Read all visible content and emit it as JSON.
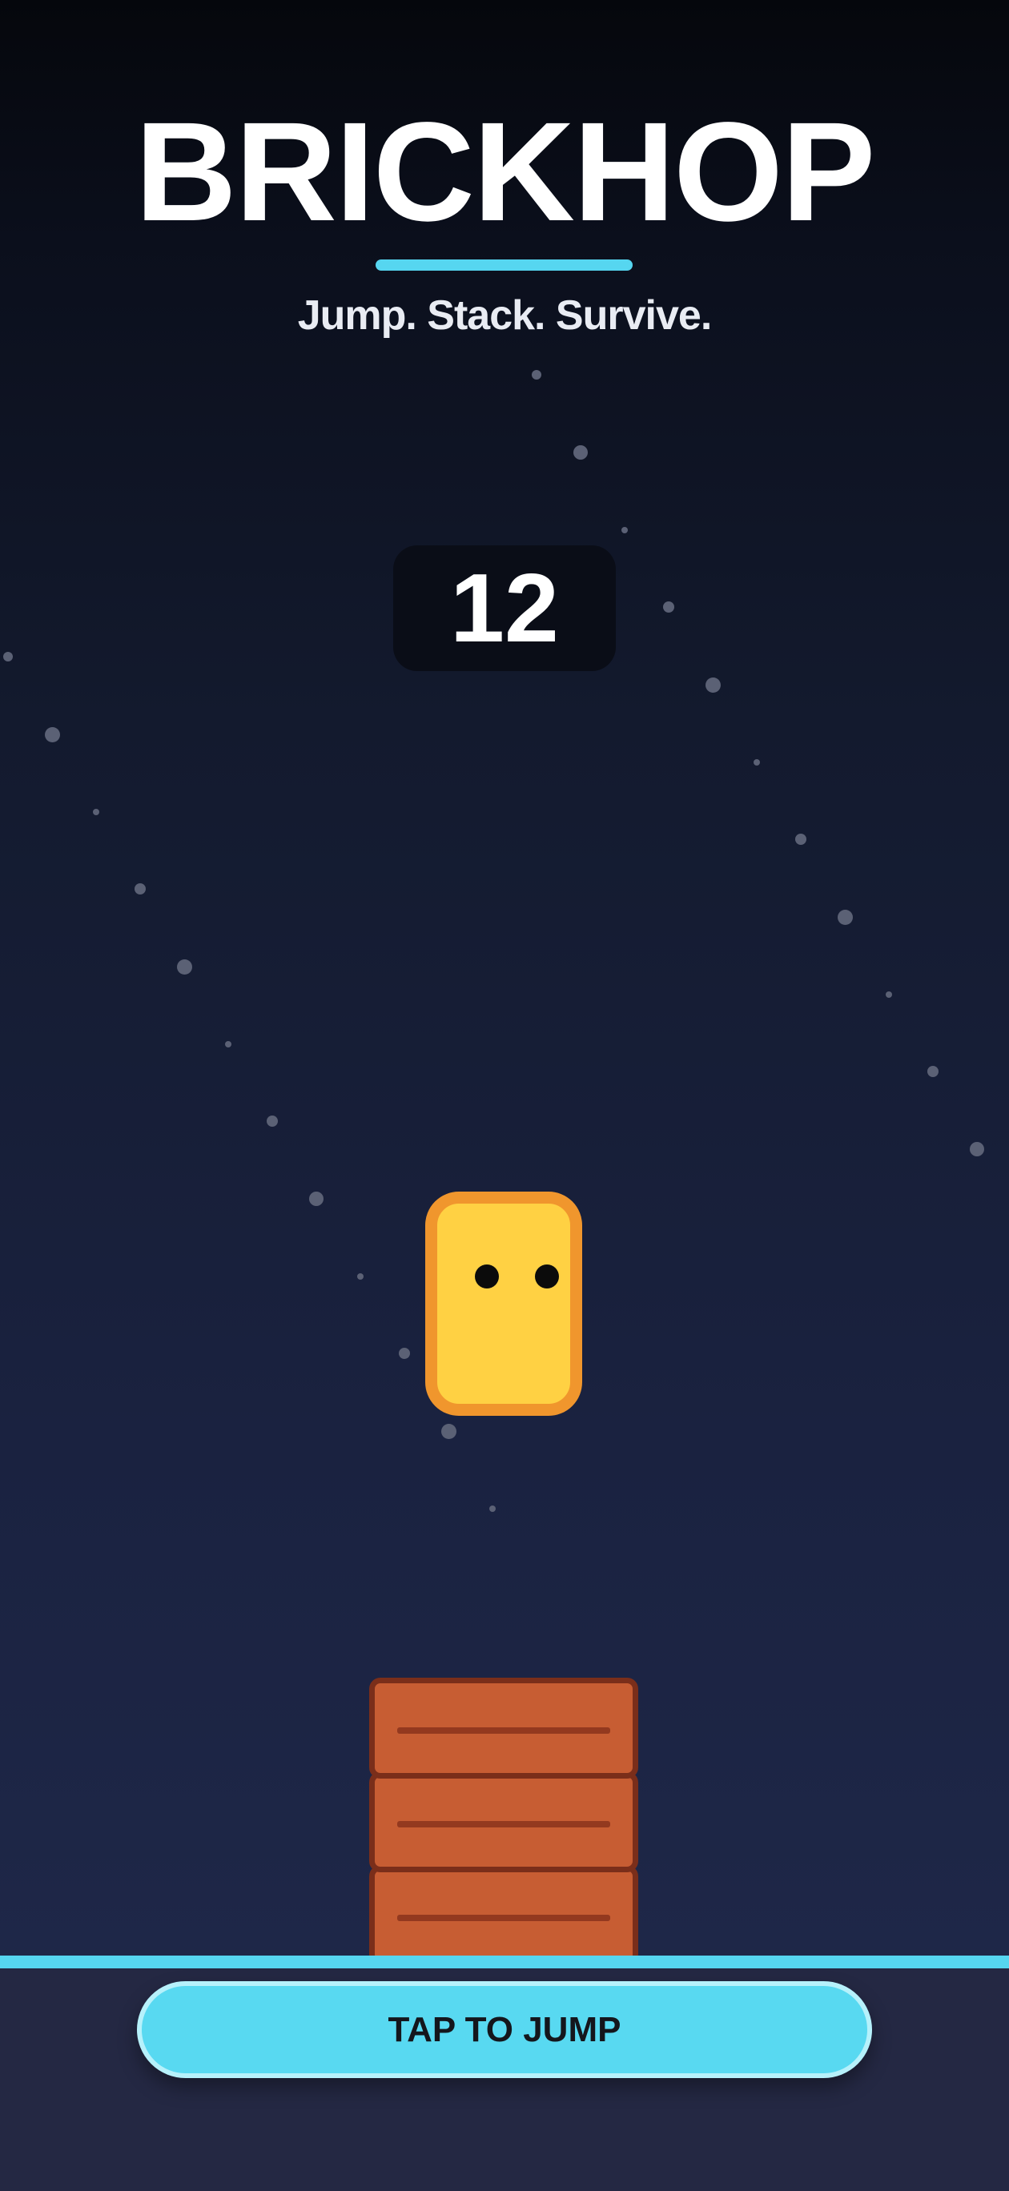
{
  "game": {
    "title": "BRICKHOP",
    "tagline": "Jump. Stack. Survive.",
    "score": "12",
    "stacked_bricks": 3,
    "action_button_label": "TAP TO JUMP"
  },
  "colors": {
    "accent": "#56d6f0",
    "player_fill": "#ffd143",
    "player_outline": "#f0962d",
    "brick_fill": "#c75d33",
    "brick_outline": "#7a2e1a",
    "ground": "#242843",
    "score_panel": "#0a0d17"
  }
}
